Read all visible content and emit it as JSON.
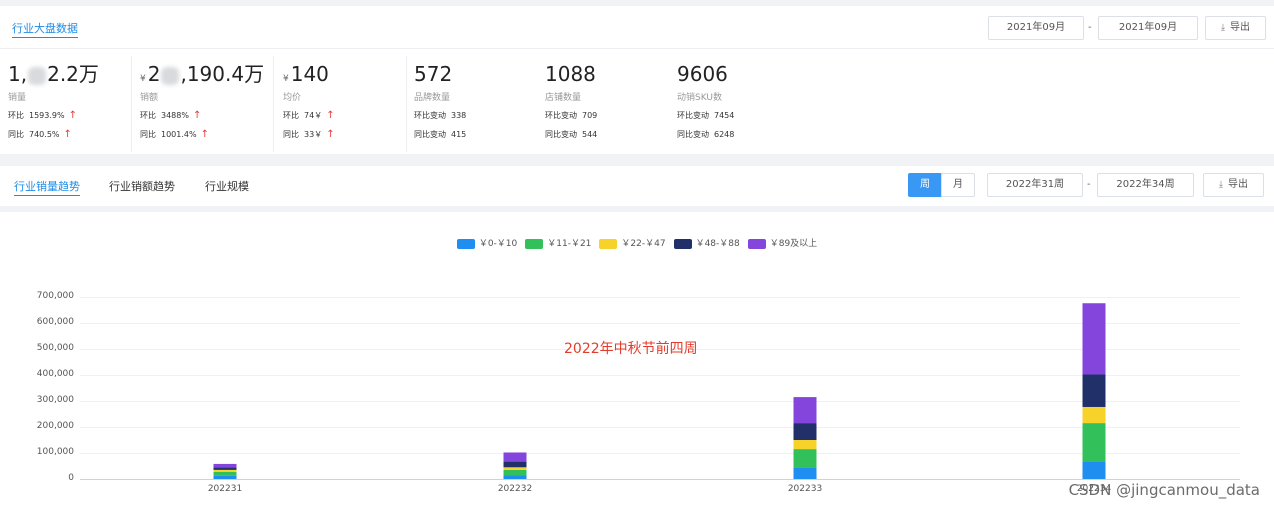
{
  "top": {
    "tab_label": "行业大盘数据",
    "date_start": "2021年09月",
    "date_sep": "-",
    "date_end": "2021年09月",
    "export_label": "导出",
    "metrics": [
      {
        "value_pre": "1,",
        "value_post": "2.2万",
        "currency": "",
        "label": "销量",
        "row1_label": "环比",
        "row1_value": "1593.9%",
        "row2_label": "同比",
        "row2_value": "740.5%",
        "arrows": true
      },
      {
        "value_pre": "2",
        "value_post": ",190.4万",
        "currency": "¥",
        "label": "销额",
        "row1_label": "环比",
        "row1_value": "3488%",
        "row2_label": "同比",
        "row2_value": "1001.4%",
        "arrows": true
      },
      {
        "value_pre": "140",
        "value_post": "",
        "currency": "¥",
        "label": "均价",
        "row1_label": "环比",
        "row1_value": "74￥",
        "row2_label": "同比",
        "row2_value": "33￥",
        "arrows": true
      },
      {
        "value_pre": "572",
        "value_post": "",
        "currency": "",
        "label": "品牌数量",
        "row1_label": "环比变动",
        "row1_value": "338",
        "row2_label": "同比变动",
        "row2_value": "415",
        "arrows": false
      },
      {
        "value_pre": "1088",
        "value_post": "",
        "currency": "",
        "label": "店铺数量",
        "row1_label": "环比变动",
        "row1_value": "709",
        "row2_label": "同比变动",
        "row2_value": "544",
        "arrows": false
      },
      {
        "value_pre": "9606",
        "value_post": "",
        "currency": "",
        "label": "动销SKU数",
        "row1_label": "环比变动",
        "row1_value": "7454",
        "row2_label": "同比变动",
        "row2_value": "6248",
        "arrows": false
      }
    ]
  },
  "trend": {
    "tabs": [
      "行业销量趋势",
      "行业销额趋势",
      "行业规模"
    ],
    "active_tab": 0,
    "period_week": "周",
    "period_month": "月",
    "date_start": "2022年31周",
    "date_sep": "-",
    "date_end": "2022年34周",
    "export_label": "导出"
  },
  "chart_data": {
    "type": "bar",
    "stacked": true,
    "categories": [
      "202231",
      "202232",
      "202233",
      "202234"
    ],
    "series": [
      {
        "name": "￥0-￥10",
        "color": "#1f8ef1",
        "values": [
          12000,
          15000,
          45000,
          68000
        ]
      },
      {
        "name": "￥11-￥21",
        "color": "#31c05a",
        "values": [
          15000,
          20000,
          70000,
          147000
        ]
      },
      {
        "name": "￥22-￥47",
        "color": "#f7d22a",
        "values": [
          8000,
          10000,
          35000,
          62000
        ]
      },
      {
        "name": "￥48-￥88",
        "color": "#22306a",
        "values": [
          10000,
          22000,
          65000,
          125000
        ]
      },
      {
        "name": "￥89及以上",
        "color": "#8445dc",
        "values": [
          13000,
          35000,
          100000,
          274000
        ]
      }
    ],
    "yticks": [
      "700,000",
      "600,000",
      "500,000",
      "400,000",
      "300,000",
      "200,000",
      "100,000",
      "0"
    ],
    "ylim": [
      0,
      700000
    ],
    "grid": true,
    "legend": "top-center",
    "annotation": "2022年中秋节前四周"
  },
  "watermark": "CSDN @jingcanmou_data"
}
